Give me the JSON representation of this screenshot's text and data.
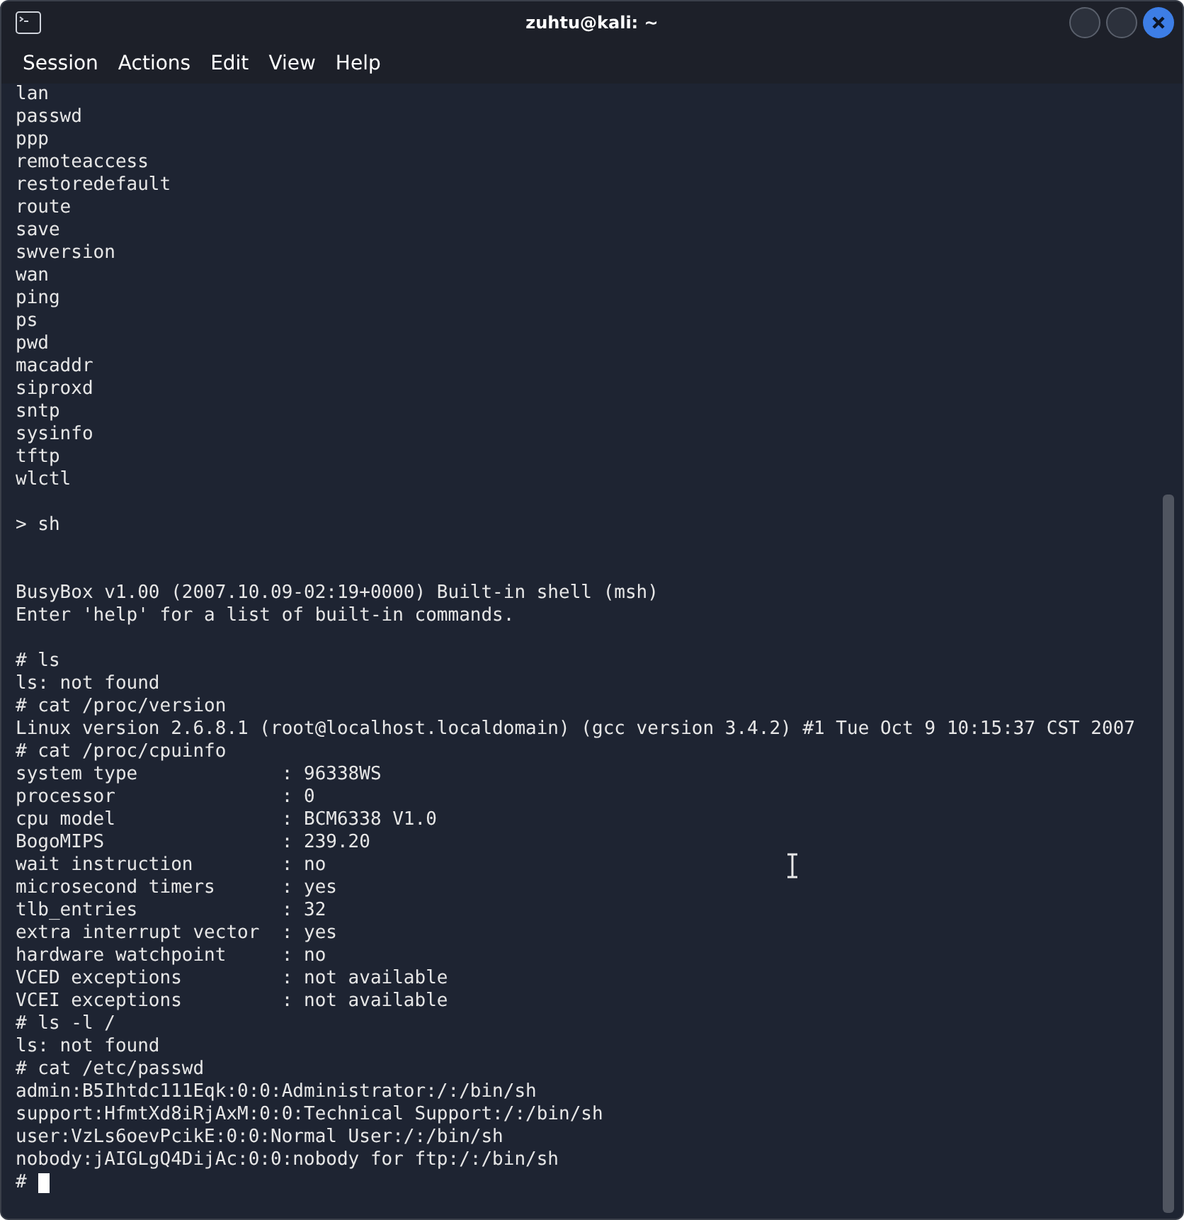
{
  "window": {
    "title": "zuhtu@kali: ~"
  },
  "menu": [
    "Session",
    "Actions",
    "Edit",
    "View",
    "Help"
  ],
  "terminal": {
    "lines": [
      {
        "kind": "output",
        "text": "lan"
      },
      {
        "kind": "output",
        "text": "passwd"
      },
      {
        "kind": "output",
        "text": "ppp"
      },
      {
        "kind": "output",
        "text": "remoteaccess"
      },
      {
        "kind": "output",
        "text": "restoredefault"
      },
      {
        "kind": "output",
        "text": "route"
      },
      {
        "kind": "output",
        "text": "save"
      },
      {
        "kind": "output",
        "text": "swversion"
      },
      {
        "kind": "output",
        "text": "wan"
      },
      {
        "kind": "output",
        "text": "ping"
      },
      {
        "kind": "output",
        "text": "ps"
      },
      {
        "kind": "output",
        "text": "pwd"
      },
      {
        "kind": "output",
        "text": "macaddr"
      },
      {
        "kind": "output",
        "text": "siproxd"
      },
      {
        "kind": "output",
        "text": "sntp"
      },
      {
        "kind": "output",
        "text": "sysinfo"
      },
      {
        "kind": "output",
        "text": "tftp"
      },
      {
        "kind": "output",
        "text": "wlctl"
      },
      {
        "kind": "blank"
      },
      {
        "kind": "output",
        "text": "> sh"
      },
      {
        "kind": "blank"
      },
      {
        "kind": "blank"
      },
      {
        "kind": "output",
        "text": "BusyBox v1.00 (2007.10.09-02:19+0000) Built-in shell (msh)"
      },
      {
        "kind": "output",
        "text": "Enter 'help' for a list of built-in commands."
      },
      {
        "kind": "blank"
      },
      {
        "kind": "output",
        "text": "# ls"
      },
      {
        "kind": "output",
        "text": "ls: not found"
      },
      {
        "kind": "output",
        "text": "# cat /proc/version"
      },
      {
        "kind": "output",
        "text": "Linux version 2.6.8.1 (root@localhost.localdomain) (gcc version 3.4.2) #1 Tue Oct 9 10:15:37 CST 2007"
      },
      {
        "kind": "output",
        "text": "# cat /proc/cpuinfo"
      },
      {
        "kind": "output",
        "text": "system type             : 96338WS"
      },
      {
        "kind": "output",
        "text": "processor               : 0"
      },
      {
        "kind": "output",
        "text": "cpu model               : BCM6338 V1.0"
      },
      {
        "kind": "output",
        "text": "BogoMIPS                : 239.20"
      },
      {
        "kind": "output",
        "text": "wait instruction        : no"
      },
      {
        "kind": "output",
        "text": "microsecond timers      : yes"
      },
      {
        "kind": "output",
        "text": "tlb_entries             : 32"
      },
      {
        "kind": "output",
        "text": "extra interrupt vector  : yes"
      },
      {
        "kind": "output",
        "text": "hardware watchpoint     : no"
      },
      {
        "kind": "output",
        "text": "VCED exceptions         : not available"
      },
      {
        "kind": "output",
        "text": "VCEI exceptions         : not available"
      },
      {
        "kind": "output",
        "text": "# ls -l /"
      },
      {
        "kind": "output",
        "text": "ls: not found"
      },
      {
        "kind": "output",
        "text": "# cat /etc/passwd"
      },
      {
        "kind": "output",
        "text": "admin:B5Ihtdc111Eqk:0:0:Administrator:/:/bin/sh"
      },
      {
        "kind": "output",
        "text": "support:HfmtXd8iRjAxM:0:0:Technical Support:/:/bin/sh"
      },
      {
        "kind": "output",
        "text": "user:VzLs6oevPcikE:0:0:Normal User:/:/bin/sh"
      },
      {
        "kind": "output",
        "text": "nobody:jAIGLgQ4DijAc:0:0:nobody for ftp:/:/bin/sh"
      },
      {
        "kind": "prompt",
        "text": "#"
      }
    ]
  }
}
